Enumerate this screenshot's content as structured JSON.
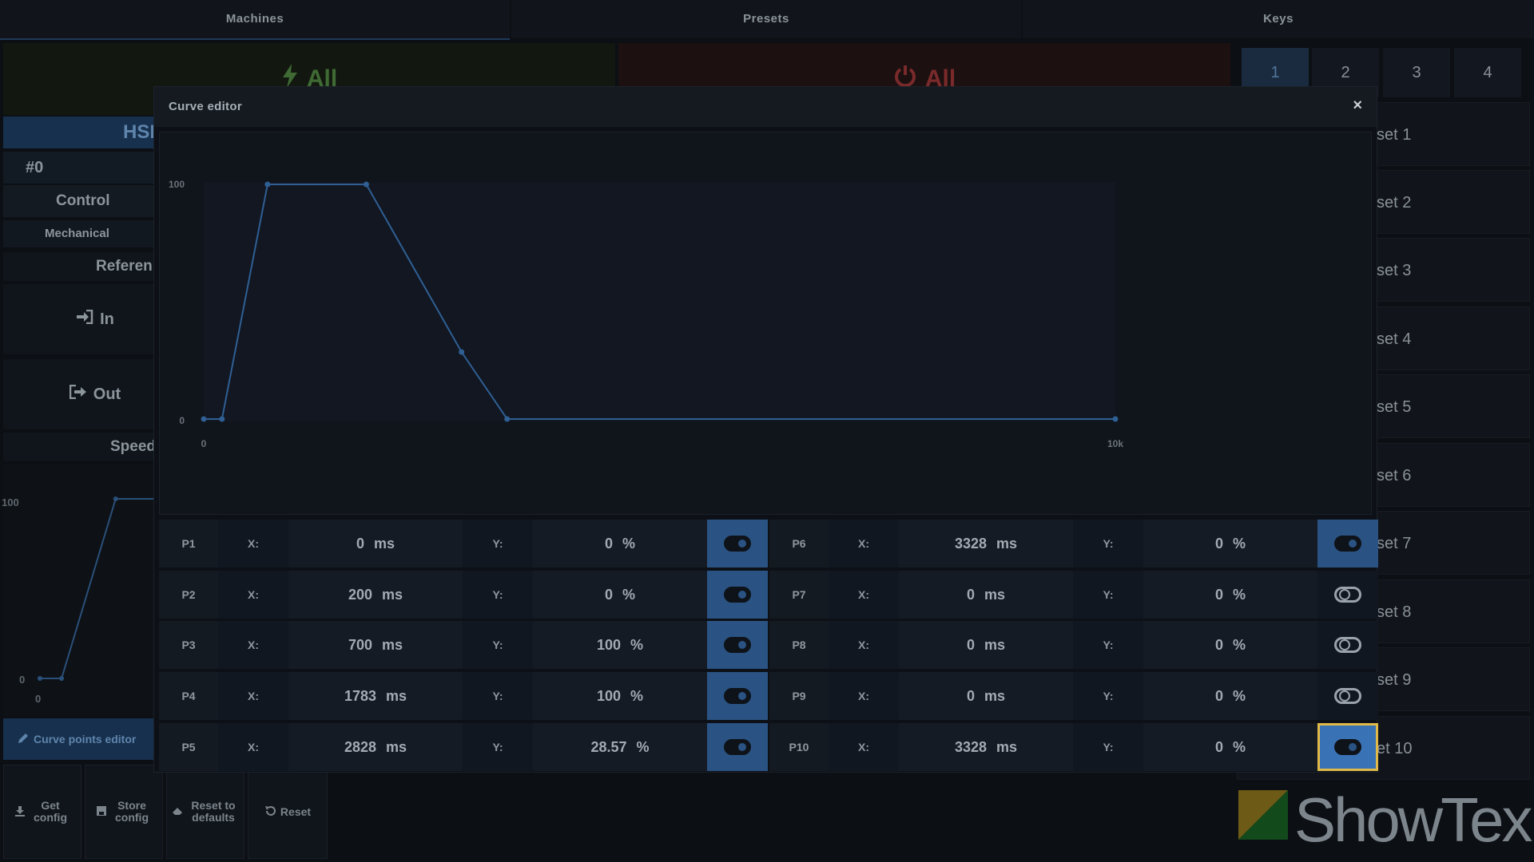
{
  "nav": {
    "tabs": [
      "Machines",
      "Presets",
      "Keys"
    ]
  },
  "top_buttons": {
    "on_all": "All",
    "off_all": "All"
  },
  "left": {
    "header": "HSI",
    "address": "#0",
    "control": "Control",
    "mechanical": "Mechanical",
    "reference": "Referen",
    "in_label": "In",
    "out_label": "Out",
    "speed": "Speed",
    "mini_chart_ymax": "100",
    "mini_chart_ymin": "0",
    "mini_chart_xmin": "0",
    "curve_btn": "Curve points editor"
  },
  "footer": {
    "get_config": "Get config",
    "store_config": "Store config",
    "reset_defaults": "Reset to defaults",
    "reset": "Reset"
  },
  "keys": {
    "tabs": [
      "1",
      "2",
      "3",
      "4"
    ],
    "presets": [
      "set 1",
      "set 2",
      "set 3",
      "set 4",
      "set 5",
      "set 6",
      "set 7",
      "set 8",
      "set 9",
      "et 10"
    ]
  },
  "brand": {
    "name": "ShowTex"
  },
  "modal": {
    "title": "Curve editor",
    "close": "×",
    "x_label": "X:",
    "y_label": "Y:",
    "x_unit": "ms",
    "y_unit": "%",
    "points": [
      {
        "name": "P1",
        "x": "0",
        "y": "0",
        "enabled": true
      },
      {
        "name": "P2",
        "x": "200",
        "y": "0",
        "enabled": true
      },
      {
        "name": "P3",
        "x": "700",
        "y": "100",
        "enabled": true
      },
      {
        "name": "P4",
        "x": "1783",
        "y": "100",
        "enabled": true
      },
      {
        "name": "P5",
        "x": "2828",
        "y": "28.57",
        "enabled": true
      },
      {
        "name": "P6",
        "x": "3328",
        "y": "0",
        "enabled": true
      },
      {
        "name": "P7",
        "x": "0",
        "y": "0",
        "enabled": false
      },
      {
        "name": "P8",
        "x": "0",
        "y": "0",
        "enabled": false
      },
      {
        "name": "P9",
        "x": "0",
        "y": "0",
        "enabled": false
      },
      {
        "name": "P10",
        "x": "3328",
        "y": "0",
        "enabled": true
      }
    ]
  },
  "chart_data": {
    "type": "line",
    "x": [
      0,
      200,
      700,
      1783,
      2828,
      3328,
      10000
    ],
    "y": [
      0,
      0,
      100,
      100,
      28.57,
      0,
      0
    ],
    "xlim": [
      0,
      10000
    ],
    "ylim": [
      0,
      100
    ],
    "x_tick_labels": [
      "0",
      "10k"
    ],
    "y_tick_labels": [
      "0",
      "100"
    ],
    "xlabel": "",
    "ylabel": "",
    "title": "",
    "color": "#2f5f93"
  }
}
